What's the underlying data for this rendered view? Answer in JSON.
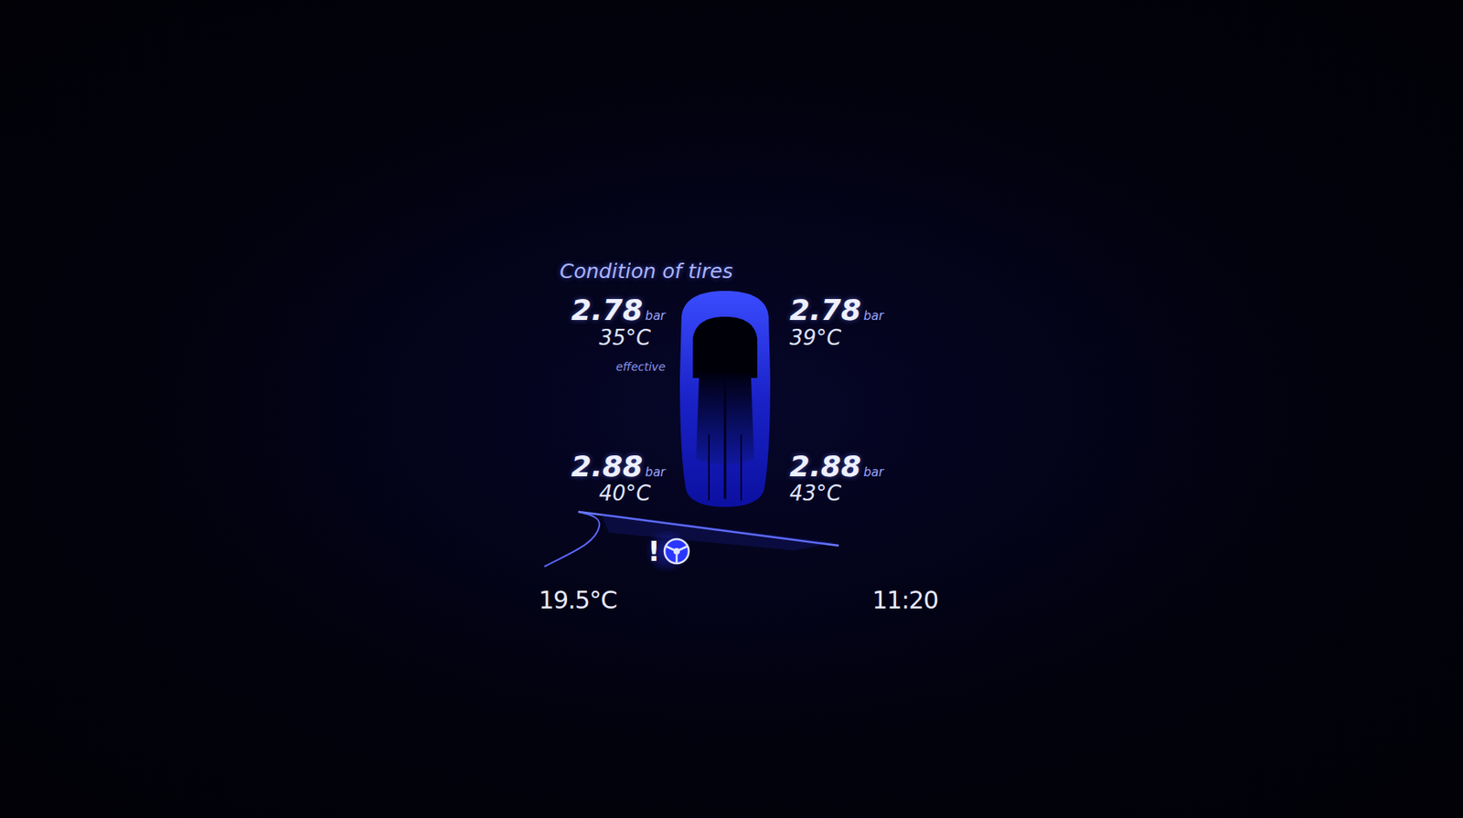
{
  "screen": {
    "title": "Condition of tires"
  },
  "tires": [
    {
      "position": "front-left",
      "pressure": "2.78",
      "unit": "bar",
      "temperature": "35",
      "temp_unit": "°C",
      "note": "effective"
    },
    {
      "position": "front-right",
      "pressure": "2.78",
      "unit": "bar",
      "temperature": "39",
      "temp_unit": "°C"
    },
    {
      "position": "rear-left",
      "pressure": "2.88",
      "unit": "bar",
      "temperature": "40",
      "temp_unit": "°C"
    },
    {
      "position": "rear-right",
      "pressure": "2.88",
      "unit": "bar",
      "temperature": "43",
      "temp_unit": "°C"
    }
  ],
  "warning": {
    "symbol": "!"
  },
  "status_bar": {
    "outside_temperature": "19.5°C",
    "time": "11:20"
  }
}
